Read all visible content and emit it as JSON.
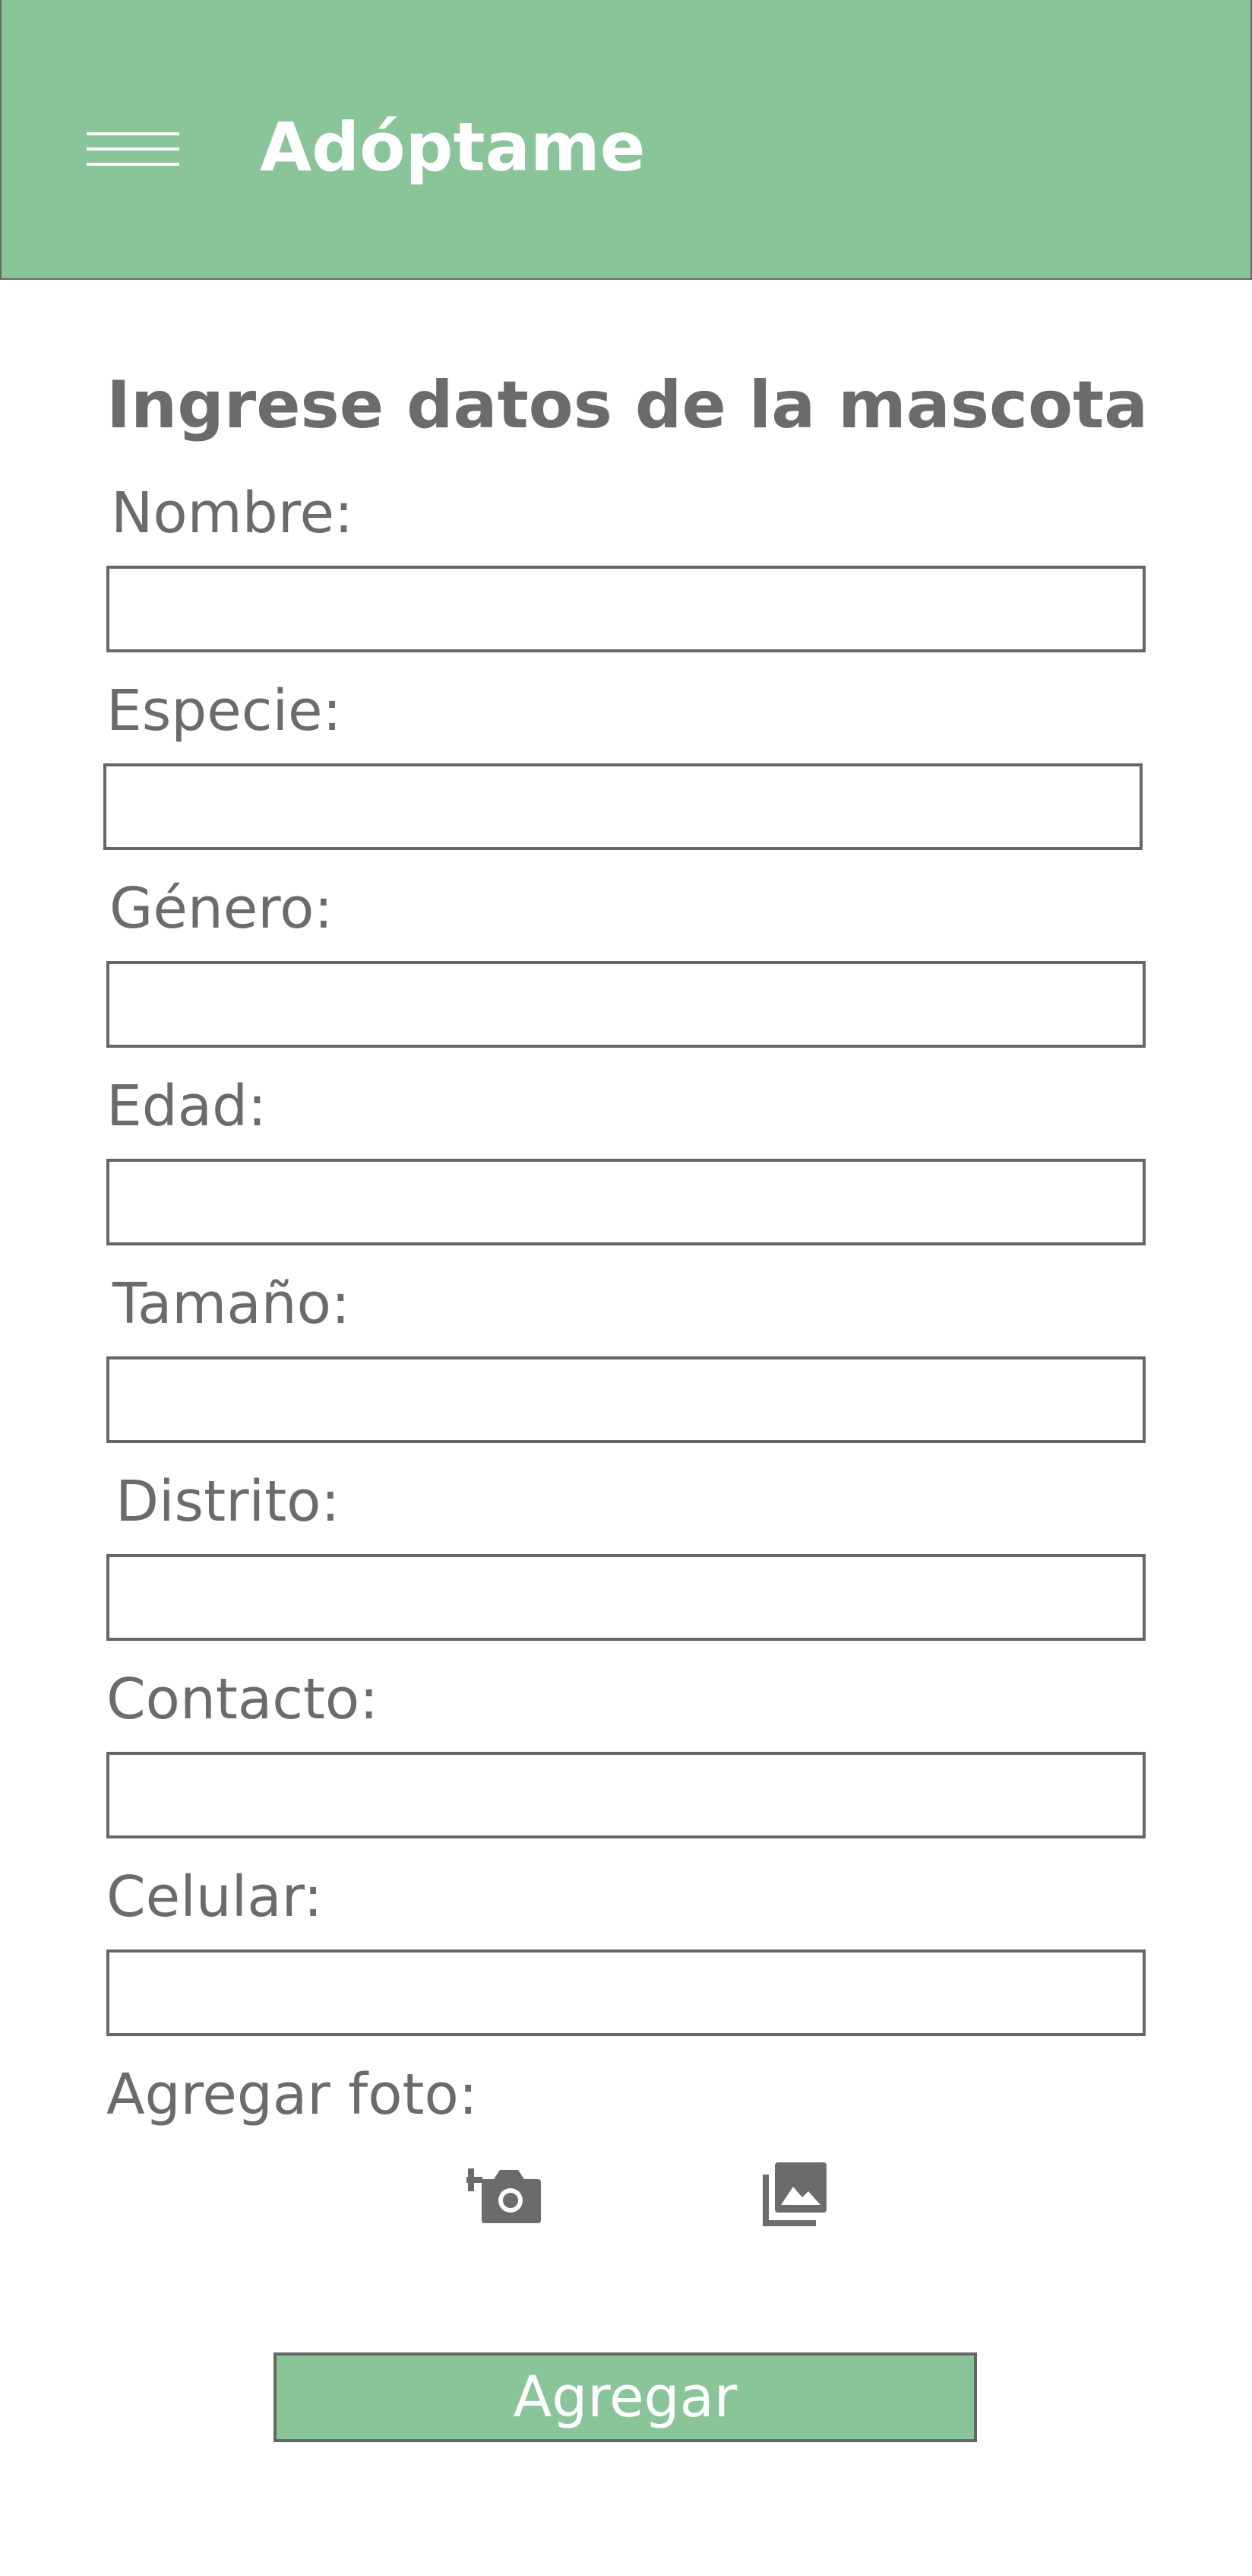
{
  "header": {
    "title": "Adóptame",
    "menu_icon": "hamburger-menu-icon",
    "background_color": "#8ac499"
  },
  "form": {
    "heading": "Ingrese datos de la mascota",
    "fields": [
      {
        "label": "Nombre:",
        "value": ""
      },
      {
        "label": "Especie:",
        "value": ""
      },
      {
        "label": "Género:",
        "value": ""
      },
      {
        "label": "Edad:",
        "value": ""
      },
      {
        "label": "Tamaño:",
        "value": ""
      },
      {
        "label": "Distrito:",
        "value": ""
      },
      {
        "label": "Contacto:",
        "value": ""
      },
      {
        "label": "Celular:",
        "value": ""
      }
    ],
    "photo": {
      "label": "Agregar foto:",
      "camera_icon": "add-photo-camera-icon",
      "gallery_icon": "photo-gallery-icon"
    },
    "submit_label": "Agregar"
  },
  "colors": {
    "accent": "#8ac499",
    "text": "#6b6b6b",
    "border": "#666666"
  }
}
